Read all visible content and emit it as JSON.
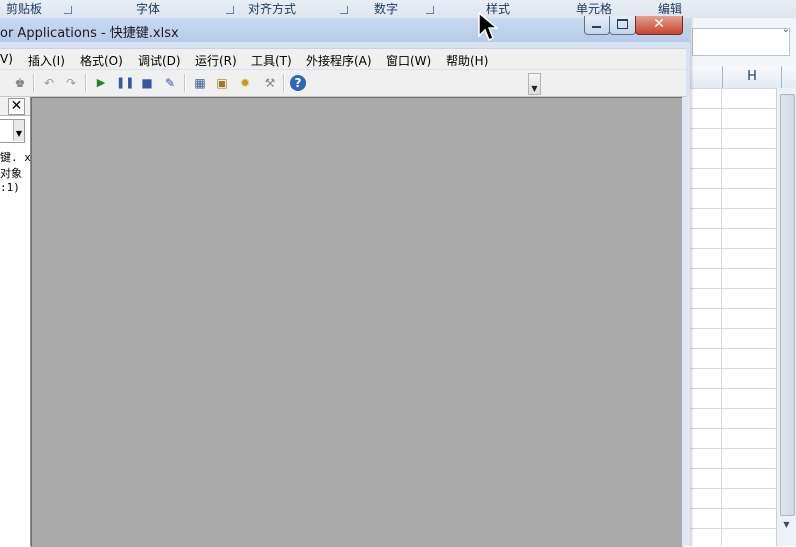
{
  "excel": {
    "ribbon_groups": [
      "剪贴板",
      "字体",
      "对齐方式",
      "数字",
      "样式",
      "单元格",
      "编辑"
    ],
    "column_header": "H"
  },
  "vbe": {
    "title": "or Applications - 快捷键.xlsx",
    "menu": [
      "V)",
      "插入(I)",
      "格式(O)",
      "调试(D)",
      "运行(R)",
      "工具(T)",
      "外接程序(A)",
      "窗口(W)",
      "帮助(H)"
    ],
    "project_pane": {
      "close_label": "✕",
      "lines": [
        "键. x",
        " 对象",
        ":1)"
      ]
    },
    "toolbar_icons": [
      "find-icon",
      "undo-icon",
      "redo-icon",
      "run-icon",
      "break-icon",
      "reset-icon",
      "design-mode-icon",
      "project-explorer-icon",
      "properties-icon",
      "object-browser-icon",
      "toolbox-icon",
      "help-icon"
    ],
    "help_glyph": "?"
  },
  "colors": {
    "code_area_bg": "#ababab",
    "titlebar": "#b5cbe8",
    "close_button": "#c6462d"
  }
}
